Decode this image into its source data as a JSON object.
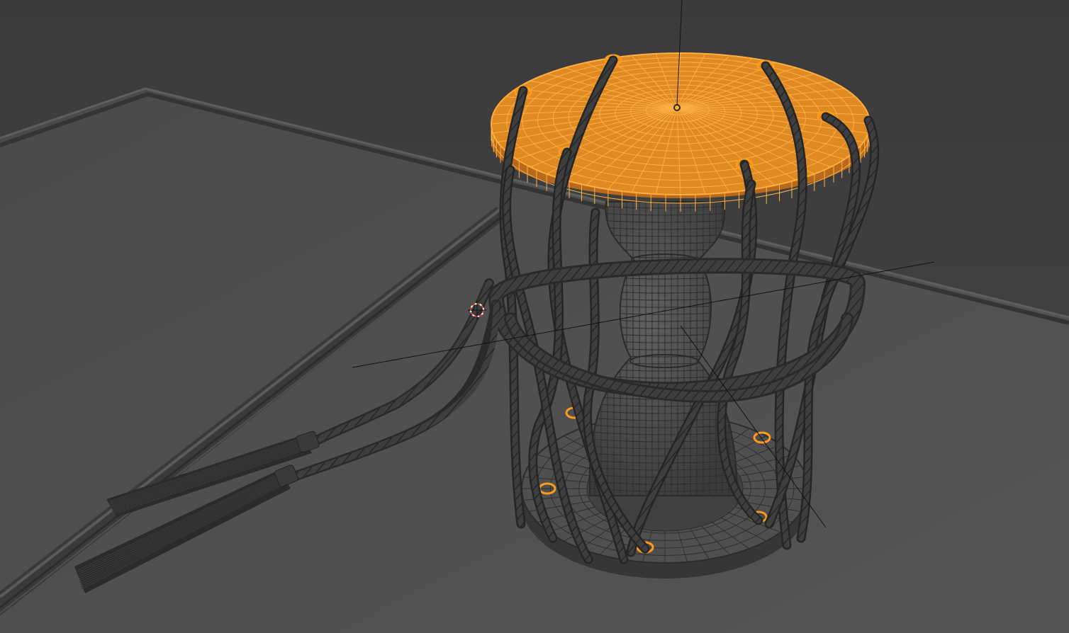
{
  "viewport": {
    "background_color": "#3f3f3f",
    "ground_color": "#4d4d4d",
    "selection_color": "#ff9a1a",
    "object_color": "#525252",
    "wire_color": "#2a2a2a",
    "axis_color": "#111111",
    "cursor_color": "#e04040"
  },
  "scene": {
    "selected_object": "drum-top-head",
    "objects": [
      "ground-plane",
      "stick",
      "drum-body",
      "drum-top-head",
      "drum-bottom-head",
      "ropes",
      "rope-tassels",
      "rope-rings",
      "3d-cursor"
    ],
    "icons": [
      "3d-cursor-icon",
      "object-origin-icon"
    ]
  }
}
